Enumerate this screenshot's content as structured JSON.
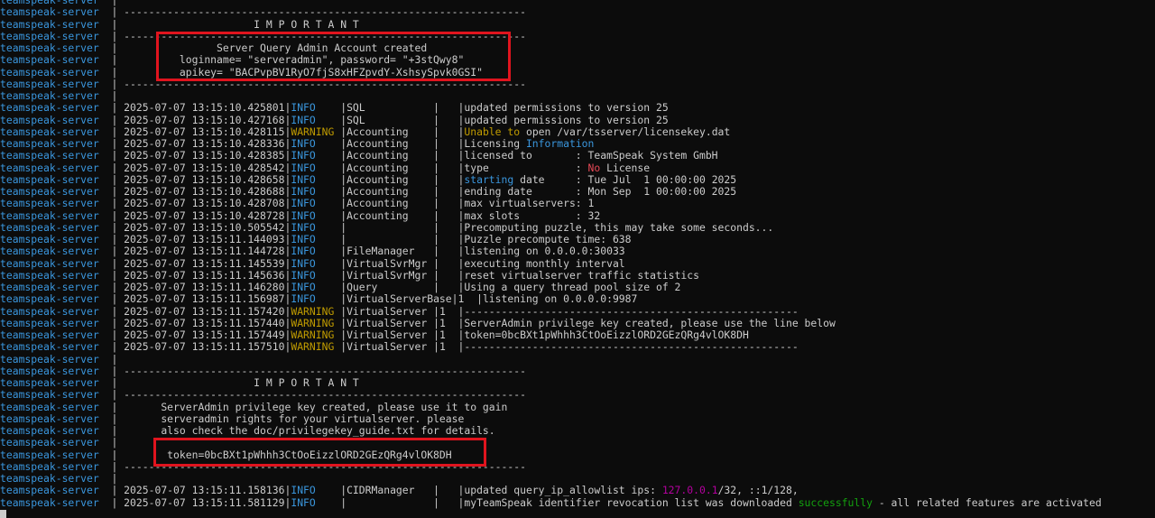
{
  "service": "teamspeak-server",
  "colors": {
    "info": "#3a96dd",
    "warning": "#c19c00",
    "highlight_box": "#e0141e"
  },
  "lines": [
    [
      [
        "bar",
        ""
      ]
    ],
    [
      [
        "bar",
        "-----------------------------------------------------------------"
      ]
    ],
    [
      [
        "bar",
        "                     I M P O R T A N T"
      ]
    ],
    [
      [
        "bar",
        "-----------------------------------------------------------------"
      ]
    ],
    [
      [
        "bar",
        "               Server Query Admin Account created"
      ]
    ],
    [
      [
        "bar",
        "         loginname= \"serveradmin\", password= \"+3stQwy8\""
      ]
    ],
    [
      [
        "bar",
        "         apikey= \"BACPvpBV1RyO7fjS8xHFZpvdY-XshsySpvk0GSI\""
      ]
    ],
    [
      [
        "bar",
        "-----------------------------------------------------------------"
      ]
    ],
    [
      [
        "bar",
        ""
      ]
    ],
    [
      [
        "bar",
        "2025-07-07 13:15:10.425801|"
      ],
      [
        "info",
        "INFO"
      ],
      [
        "bar",
        "    |SQL           |   |updated permissions to version 25"
      ]
    ],
    [
      [
        "bar",
        "2025-07-07 13:15:10.427168|"
      ],
      [
        "info",
        "INFO"
      ],
      [
        "bar",
        "    |SQL           |   |updated permissions to version 25"
      ]
    ],
    [
      [
        "bar",
        "2025-07-07 13:15:10.428115|"
      ],
      [
        "warn",
        "WARNING"
      ],
      [
        "bar",
        " |Accounting    |   |"
      ],
      [
        "warn",
        "Unable to"
      ],
      [
        "bar",
        " open /var/tsserver/licensekey.dat"
      ]
    ],
    [
      [
        "bar",
        "2025-07-07 13:15:10.428336|"
      ],
      [
        "info",
        "INFO"
      ],
      [
        "bar",
        "    |Accounting    |   |Licensing "
      ],
      [
        "info",
        "Information"
      ]
    ],
    [
      [
        "bar",
        "2025-07-07 13:15:10.428385|"
      ],
      [
        "info",
        "INFO"
      ],
      [
        "bar",
        "    |Accounting    |   |licensed to       : TeamSpeak System GmbH"
      ]
    ],
    [
      [
        "bar",
        "2025-07-07 13:15:10.428542|"
      ],
      [
        "info",
        "INFO"
      ],
      [
        "bar",
        "    |Accounting    |   |type              : "
      ],
      [
        "red",
        "No"
      ],
      [
        "bar",
        " License"
      ]
    ],
    [
      [
        "bar",
        "2025-07-07 13:15:10.428658|"
      ],
      [
        "info",
        "INFO"
      ],
      [
        "bar",
        "    |Accounting    |   |"
      ],
      [
        "info",
        "starting"
      ],
      [
        "bar",
        " date     : Tue Jul  1 00:00:00 2025"
      ]
    ],
    [
      [
        "bar",
        "2025-07-07 13:15:10.428688|"
      ],
      [
        "info",
        "INFO"
      ],
      [
        "bar",
        "    |Accounting    |   |ending date       : Mon Sep  1 00:00:00 2025"
      ]
    ],
    [
      [
        "bar",
        "2025-07-07 13:15:10.428708|"
      ],
      [
        "info",
        "INFO"
      ],
      [
        "bar",
        "    |Accounting    |   |max virtualservers: 1"
      ]
    ],
    [
      [
        "bar",
        "2025-07-07 13:15:10.428728|"
      ],
      [
        "info",
        "INFO"
      ],
      [
        "bar",
        "    |Accounting    |   |max slots         : 32"
      ]
    ],
    [
      [
        "bar",
        "2025-07-07 13:15:10.505542|"
      ],
      [
        "info",
        "INFO"
      ],
      [
        "bar",
        "    |              |   |Precomputing puzzle, this may take some seconds..."
      ]
    ],
    [
      [
        "bar",
        "2025-07-07 13:15:11.144093|"
      ],
      [
        "info",
        "INFO"
      ],
      [
        "bar",
        "    |              |   |Puzzle precompute time: 638"
      ]
    ],
    [
      [
        "bar",
        "2025-07-07 13:15:11.144728|"
      ],
      [
        "info",
        "INFO"
      ],
      [
        "bar",
        "    |FileManager   |   |listening on 0.0.0.0:30033"
      ]
    ],
    [
      [
        "bar",
        "2025-07-07 13:15:11.145539|"
      ],
      [
        "info",
        "INFO"
      ],
      [
        "bar",
        "    |VirtualSvrMgr |   |executing monthly interval"
      ]
    ],
    [
      [
        "bar",
        "2025-07-07 13:15:11.145636|"
      ],
      [
        "info",
        "INFO"
      ],
      [
        "bar",
        "    |VirtualSvrMgr |   |reset virtualserver traffic statistics"
      ]
    ],
    [
      [
        "bar",
        "2025-07-07 13:15:11.146280|"
      ],
      [
        "info",
        "INFO"
      ],
      [
        "bar",
        "    |Query         |   |Using a query thread pool size of 2"
      ]
    ],
    [
      [
        "bar",
        "2025-07-07 13:15:11.156987|"
      ],
      [
        "info",
        "INFO"
      ],
      [
        "bar",
        "    |VirtualServerBase|1  |listening on 0.0.0.0:9987"
      ]
    ],
    [
      [
        "bar",
        "2025-07-07 13:15:11.157420|"
      ],
      [
        "warn",
        "WARNING"
      ],
      [
        "bar",
        " |VirtualServer |1  |------------------------------------------------------"
      ]
    ],
    [
      [
        "bar",
        "2025-07-07 13:15:11.157440|"
      ],
      [
        "warn",
        "WARNING"
      ],
      [
        "bar",
        " |VirtualServer |1  |ServerAdmin privilege key created, please use the line below"
      ]
    ],
    [
      [
        "bar",
        "2025-07-07 13:15:11.157449|"
      ],
      [
        "warn",
        "WARNING"
      ],
      [
        "bar",
        " |VirtualServer |1  |token=0bcBXt1pWhhh3CtOoEizzlORD2GEzQRg4vlOK8DH"
      ]
    ],
    [
      [
        "bar",
        "2025-07-07 13:15:11.157510|"
      ],
      [
        "warn",
        "WARNING"
      ],
      [
        "bar",
        " |VirtualServer |1  |------------------------------------------------------"
      ]
    ],
    [
      [
        "bar",
        ""
      ]
    ],
    [
      [
        "bar",
        "-----------------------------------------------------------------"
      ]
    ],
    [
      [
        "bar",
        "                     I M P O R T A N T"
      ]
    ],
    [
      [
        "bar",
        "-----------------------------------------------------------------"
      ]
    ],
    [
      [
        "bar",
        "      ServerAdmin privilege key created, please use it to gain"
      ]
    ],
    [
      [
        "bar",
        "      serveradmin rights for your virtualserver. please"
      ]
    ],
    [
      [
        "bar",
        "      also check the doc/privilegekey_guide.txt for details."
      ]
    ],
    [
      [
        "bar",
        ""
      ]
    ],
    [
      [
        "bar",
        "       token=0bcBXt1pWhhh3CtOoEizzlORD2GEzQRg4vlOK8DH"
      ]
    ],
    [
      [
        "bar",
        "-----------------------------------------------------------------"
      ]
    ],
    [
      [
        "bar",
        ""
      ]
    ],
    [
      [
        "bar",
        "2025-07-07 13:15:11.158136|"
      ],
      [
        "info",
        "INFO"
      ],
      [
        "bar",
        "    |CIDRManager   |   |updated query_ip_allowlist ips: "
      ],
      [
        "mag",
        "127.0.0.1"
      ],
      [
        "bar",
        "/32, ::1/128,"
      ]
    ],
    [
      [
        "bar",
        "2025-07-07 13:15:11.581129|"
      ],
      [
        "info",
        "INFO"
      ],
      [
        "bar",
        "    |              |   |myTeamSpeak identifier revocation list was downloaded "
      ],
      [
        "grn",
        "successfully"
      ],
      [
        "bar",
        " - all related features are activated"
      ]
    ]
  ]
}
